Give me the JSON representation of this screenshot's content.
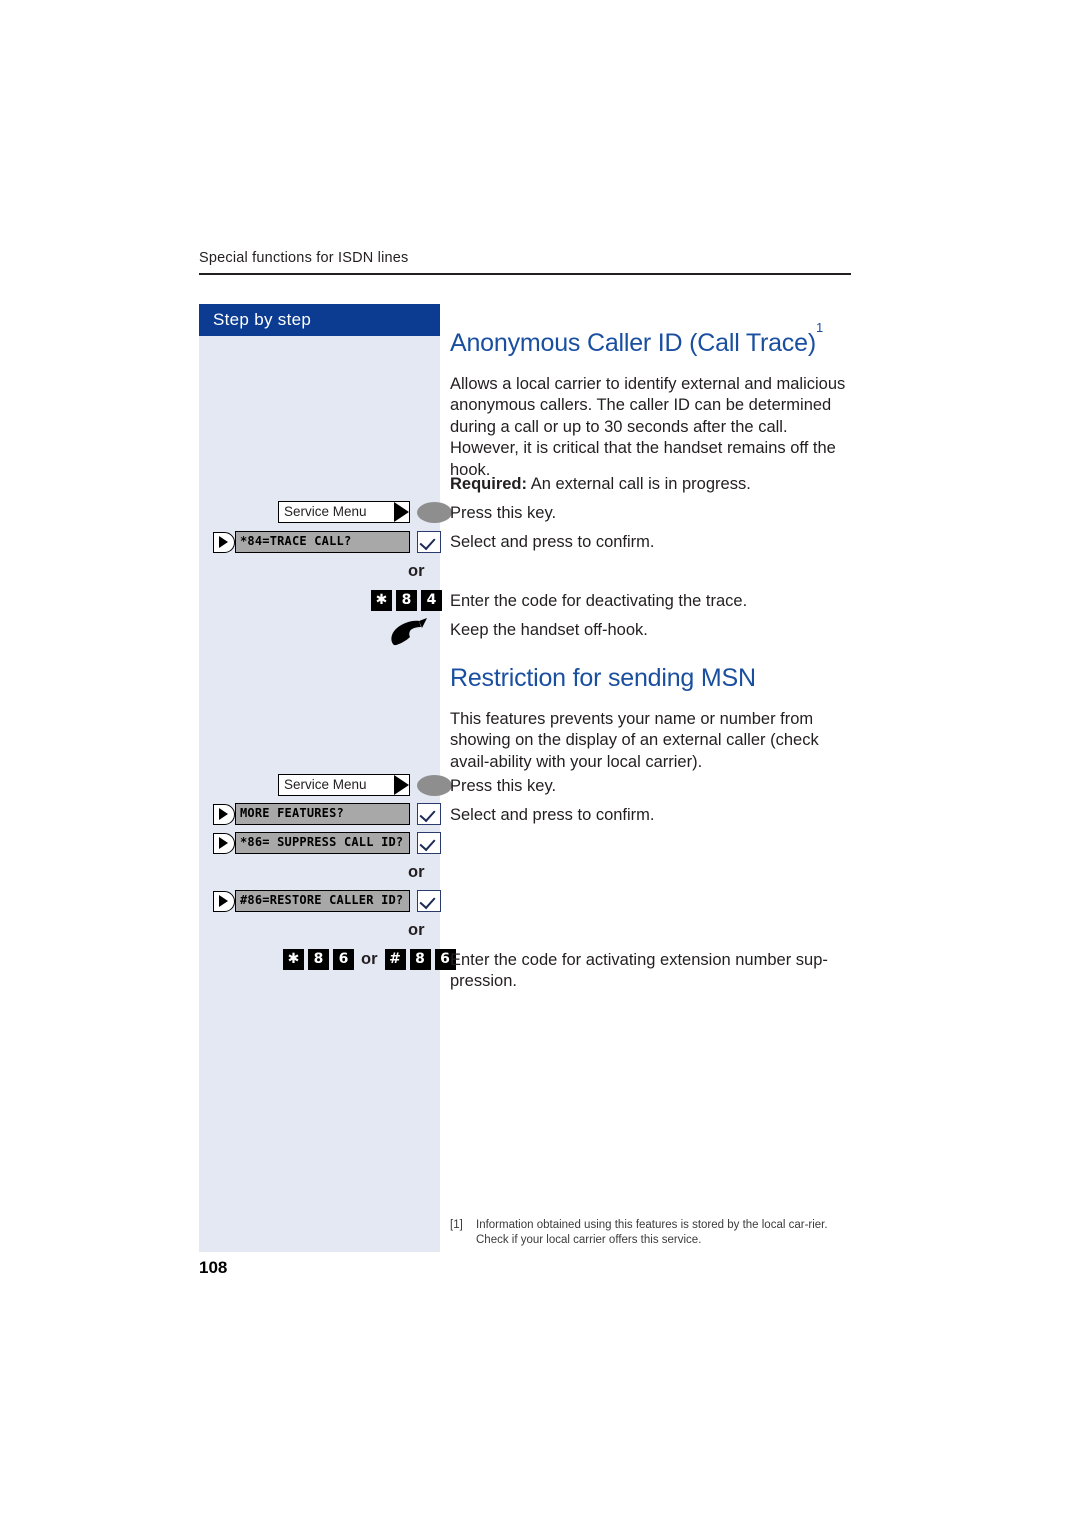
{
  "page": {
    "running_head": "Special functions for ISDN lines",
    "folio": "108",
    "sidebar_title": "Step by step",
    "colors": {
      "header_blue": "#0b3c91",
      "sidebar_bg": "#e4e8f3",
      "heading_blue": "#1a4fa0",
      "display_gray": "#a8a8a8",
      "key_gray": "#8e8e8e"
    }
  },
  "sections": [
    {
      "id": "call-trace",
      "heading": "Anonymous Caller ID (Call Trace)",
      "heading_footnote_mark": "1",
      "intro": "Allows a local carrier to identify external and malicious anonymous callers. The caller ID can be determined during a call or up to 30 seconds after the call. However, it is critical that the handset remains off the hook.",
      "required_label": "Required:",
      "required_text": " An external call is in progress.",
      "steps": [
        {
          "kind": "service-key",
          "key_label": "Service Menu",
          "instruction": "Press this key."
        },
        {
          "kind": "display-line",
          "display_text": "*84=TRACE CALL?",
          "instruction": "Select and press to confirm."
        },
        {
          "kind": "or",
          "label": "or"
        },
        {
          "kind": "keypad",
          "keys": [
            "✱",
            "8",
            "4"
          ],
          "instruction": "Enter the code for deactivating the trace."
        },
        {
          "kind": "handset",
          "instruction": "Keep the handset off-hook."
        }
      ]
    },
    {
      "id": "restriction-msn",
      "heading": "Restriction for sending MSN",
      "intro": "This features prevents your name or number from showing on the display of an external caller (check avail-ability with your local carrier).",
      "steps": [
        {
          "kind": "service-key",
          "key_label": "Service Menu",
          "instruction": "Press this key."
        },
        {
          "kind": "display-line",
          "display_text": "MORE FEATURES?",
          "instruction": "Select and press to confirm."
        },
        {
          "kind": "display-line",
          "display_text": "*86= SUPPRESS CALL ID?",
          "instruction": ""
        },
        {
          "kind": "or",
          "label": "or"
        },
        {
          "kind": "display-line",
          "display_text": "#86=RESTORE CALLER ID?",
          "instruction": ""
        },
        {
          "kind": "or",
          "label": "or"
        },
        {
          "kind": "keypad-or",
          "keys_a": [
            "✱",
            "8",
            "6"
          ],
          "separator": "or",
          "keys_b": [
            "#",
            "8",
            "6"
          ],
          "instruction": "Enter the code for activating extension number sup-pression."
        }
      ]
    }
  ],
  "footnote": {
    "mark": "[1]",
    "text": "Information obtained using this features is stored by the local car-rier. Check if your local carrier offers this service."
  }
}
